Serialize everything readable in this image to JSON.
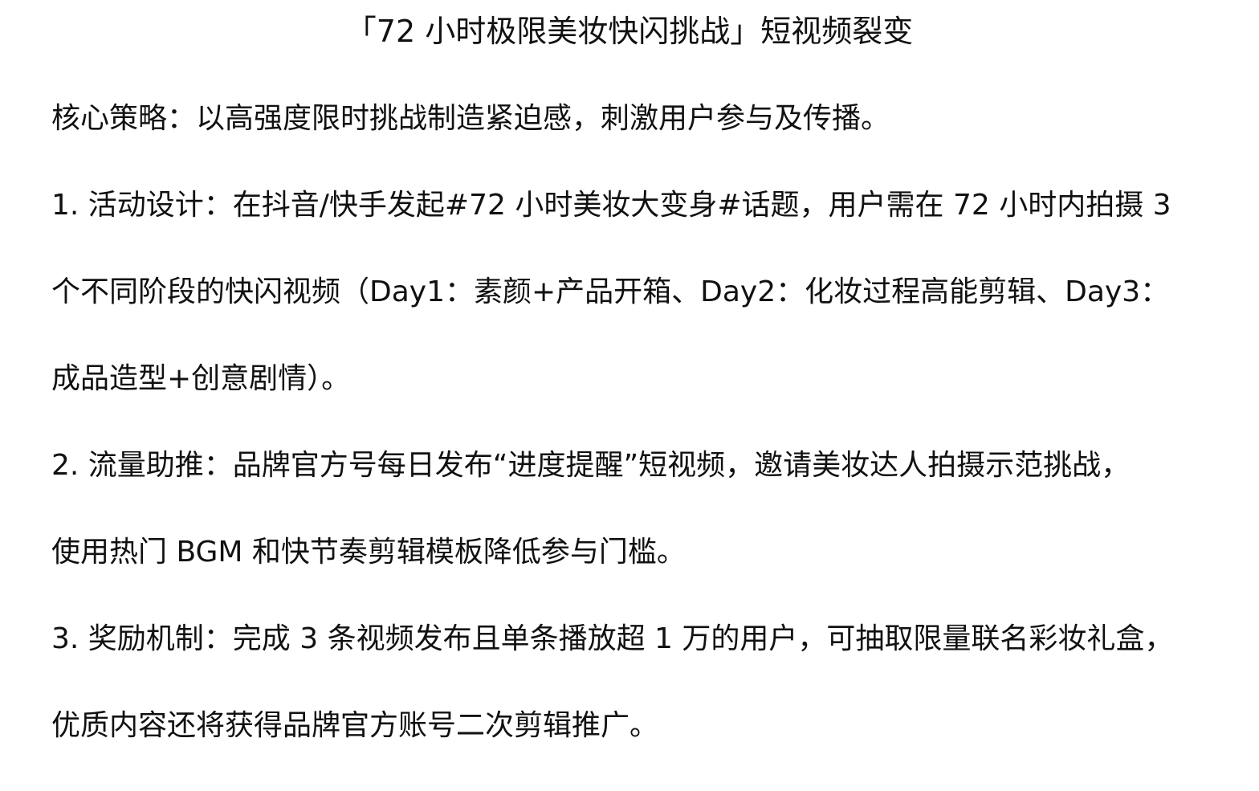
{
  "document": {
    "title": "「72 小时极限美妆快闪挑战」短视频裂变",
    "strategy": "核心策略：以高强度限时挑战制造紧迫感，刺激用户参与及传播。",
    "items": [
      {
        "lines": [
          "1. 活动设计：在抖音/快手发起#72 小时美妆大变身#话题，用户需在 72 小时内拍摄 3",
          "个不同阶段的快闪视频（Day1：素颜+产品开箱、Day2：化妆过程高能剪辑、Day3：",
          "成品造型+创意剧情）。"
        ]
      },
      {
        "lines": [
          "2. 流量助推：品牌官方号每日发布“进度提醒”短视频，邀请美妆达人拍摄示范挑战，",
          "使用热门 BGM 和快节奏剪辑模板降低参与门槛。"
        ]
      },
      {
        "lines": [
          "3. 奖励机制：完成 3 条视频发布且单条播放超 1 万的用户，可抽取限量联名彩妆礼盒，",
          "优质内容还将获得品牌官方账号二次剪辑推广。"
        ]
      }
    ]
  }
}
